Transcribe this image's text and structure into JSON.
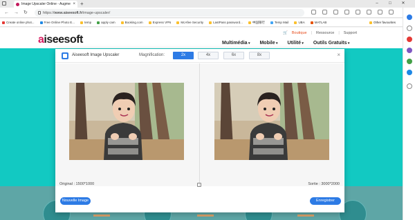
{
  "browser": {
    "tab_title": "Image Upscaler Online - Augmen",
    "tab_close": "×",
    "new_tab": "+",
    "url_prefix": "https://",
    "url_host": "www.aiseesoft.fr",
    "url_path": "/image-upscaler/",
    "bookmarks": [
      {
        "label": "Create online phot...",
        "color": "#e53935"
      },
      {
        "label": "Free Online Photo E...",
        "color": "#1e88e5"
      },
      {
        "label": "temp",
        "color": "#fbc02d"
      },
      {
        "label": "apply cam",
        "color": "#43a047"
      },
      {
        "label": "Booking.com",
        "color": "#fbc02d"
      },
      {
        "label": "Express VPN",
        "color": "#fbc02d"
      },
      {
        "label": "McAfee Security",
        "color": "#fbc02d"
      },
      {
        "label": "LastPass password...",
        "color": "#fbc02d"
      },
      {
        "label": "中国银行",
        "color": "#fbc02d"
      },
      {
        "label": "Temp Mail",
        "color": "#42a5f5"
      },
      {
        "label": "UBA",
        "color": "#fbc02d"
      },
      {
        "label": "MATLAB",
        "color": "#e65100"
      }
    ],
    "other_bookmarks": "Other favourites"
  },
  "site": {
    "logo_a": "a",
    "logo_rest": "iseesoft",
    "top_links": {
      "shop": "Boutique",
      "resource": "Ressource",
      "support": "Support"
    },
    "nav": [
      "Multimédia",
      "Mobile",
      "Utilité",
      "Outils Gratuits"
    ]
  },
  "modal": {
    "app_title": "Aiseesoft Image Upscaler",
    "magnification_label": "Magnification:",
    "magnifications": [
      "2x",
      "4x",
      "6x",
      "8x"
    ],
    "selected_magnification": "2x",
    "close": "×",
    "original_label": "Original : 1500*1000",
    "output_label": "Sortie : 3000*2000",
    "new_image_button": "Nouvelle Image",
    "save_button": "Enregistrer"
  },
  "colors": {
    "accent": "#2d7be5",
    "teal": "#12c9c2",
    "brand": "#d81b60"
  }
}
